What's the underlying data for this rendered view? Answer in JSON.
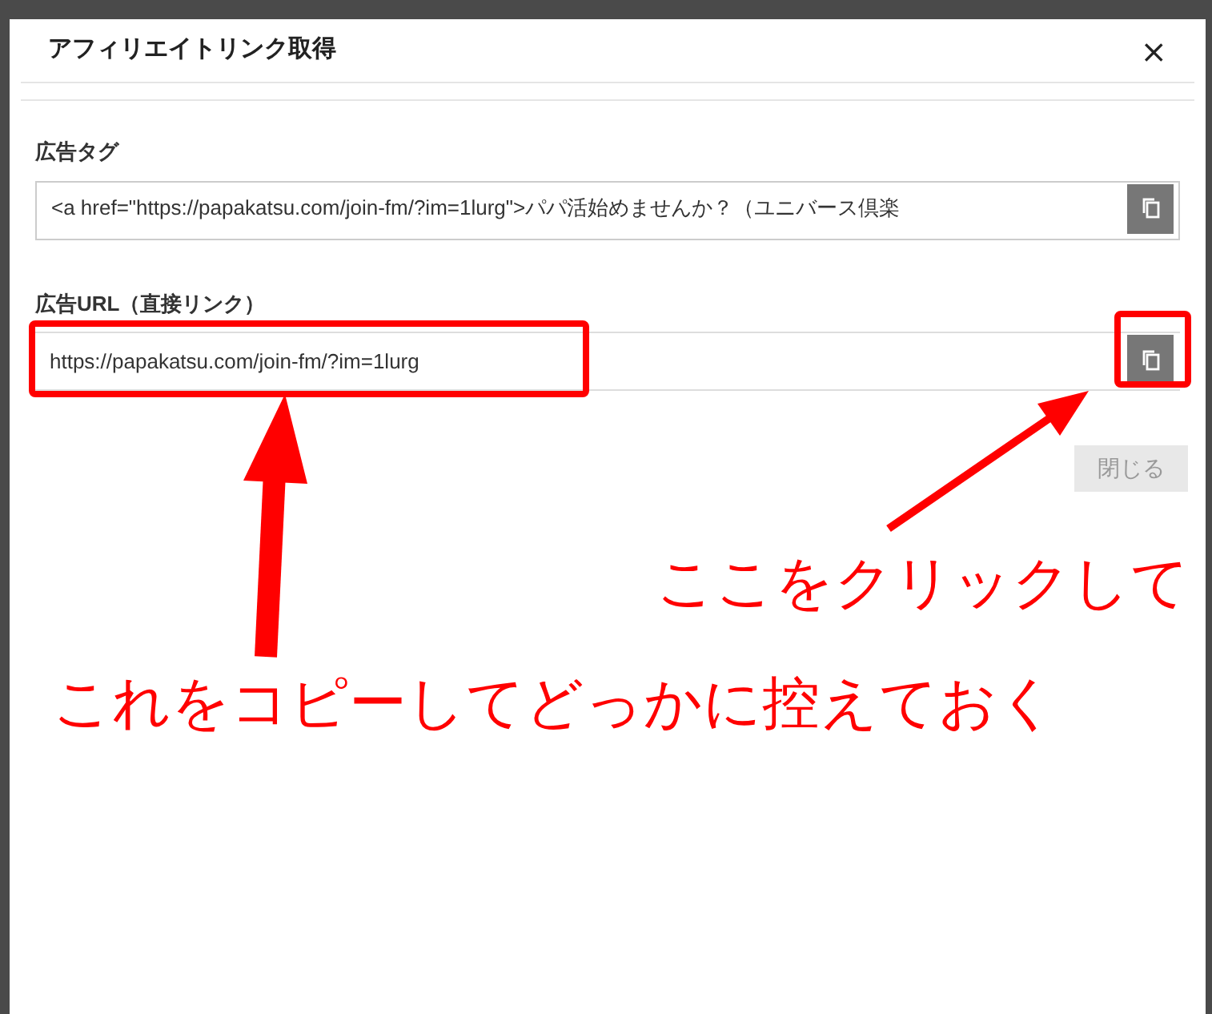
{
  "dialog": {
    "title": "アフィリエイトリンク取得",
    "close": "×"
  },
  "fields": [
    {
      "label": "広告タグ",
      "value": "<a href=\"https://papakatsu.com/join-fm/?im=1lurg\">パパ活始めませんか？（ユニバース倶楽"
    },
    {
      "label": "広告URL（直接リンク）",
      "value": "https://papakatsu.com/join-fm/?im=1lurg"
    }
  ],
  "buttons": [
    {
      "label": "閉じる",
      "disabled": true
    }
  ],
  "annotations": [
    {
      "text": "ここをクリックして"
    },
    {
      "text": "これをコピーしてどっかに控えておく"
    }
  ]
}
